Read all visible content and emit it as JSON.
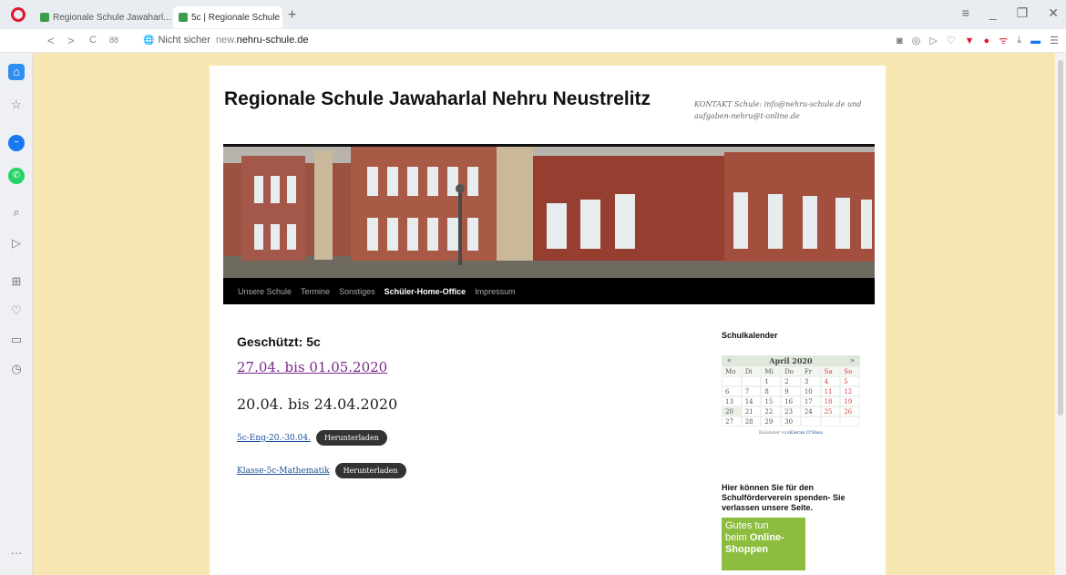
{
  "browser": {
    "tabs": [
      {
        "title": "Regionale Schule Jawaharl..."
      },
      {
        "title": "5c | Regionale Schule Jawa..."
      }
    ],
    "nav": {
      "back": "<",
      "forward": ">",
      "reload": "C",
      "tiles": "88"
    },
    "security_label": "Nicht sicher",
    "url_prefix": "new.",
    "url_domain": "nehru-schule.de"
  },
  "site": {
    "title": "Regionale Schule Jawaharlal Nehru Neustrelitz",
    "description": "KONTAKT Schule: info@nehru-schule.de und aufgaben-nehru@t-online.de",
    "menu": [
      "Unsere Schule",
      "Termine",
      "Sonstiges",
      "Schüler-Home-Office",
      "Impressum"
    ],
    "menu_current": "Schüler-Home-Office"
  },
  "content": {
    "entry_title": "Geschützt: 5c",
    "link_week": "27.04. bis 01.05.2020",
    "heading_week": "20.04. bis 24.04.2020",
    "downloads": [
      {
        "link": "5c-Eng-20.-30.04.",
        "button": "Herunterladen"
      },
      {
        "link": "Klasse-5c-Mathematik",
        "button": "Herunterladen"
      }
    ]
  },
  "calendar": {
    "widget_title": "Schulkalender",
    "prev": "«",
    "next": "»",
    "month": "April 2020",
    "weekdays": [
      "Mo",
      "Di",
      "Mi",
      "Do",
      "Fr",
      "Sa",
      "So"
    ],
    "weeks": [
      [
        "",
        "",
        "1",
        "2",
        "3",
        "4",
        "5"
      ],
      [
        "6",
        "7",
        "8",
        "9",
        "10",
        "11",
        "12"
      ],
      [
        "13",
        "14",
        "15",
        "16",
        "17",
        "18",
        "19"
      ],
      [
        "20",
        "21",
        "22",
        "23",
        "24",
        "25",
        "26"
      ],
      [
        "27",
        "28",
        "29",
        "30",
        "",
        "",
        ""
      ]
    ],
    "credit_prefix": "Kalender von",
    "credit_name": "Kieran O'Shea"
  },
  "sidebar_text": {
    "donate": "Hier können Sie für den Schulförderverein spenden- Sie verlassen unsere Seite.",
    "promo_line1": "Gutes tun",
    "promo_line2_prefix": "beim",
    "promo_line2_bold": "Online-",
    "promo_line3_bold": "Shoppen"
  },
  "colors": {
    "page_bg": "#f6e7b3",
    "nav_bg": "#000000",
    "link_visited": "#7a2a8c",
    "promo_green": "#8cbd3e"
  }
}
